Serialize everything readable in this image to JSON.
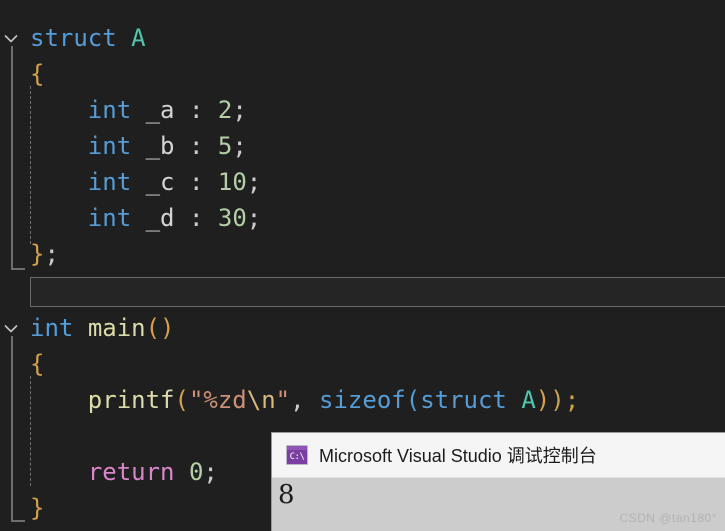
{
  "editor": {
    "background": "#1f1f1f",
    "font_size_px": 24,
    "folds": [
      {
        "name": "struct-fold",
        "icon": "chevron-down-icon"
      },
      {
        "name": "main-fold",
        "icon": "chevron-down-icon"
      }
    ],
    "lines": [
      {
        "id": "l1",
        "text": "struct A",
        "indent": 0
      },
      {
        "id": "l2",
        "text": "{",
        "indent": 0
      },
      {
        "id": "l3",
        "text": "    int _a : 2;",
        "indent": 1
      },
      {
        "id": "l4",
        "text": "    int _b : 5;",
        "indent": 1
      },
      {
        "id": "l5",
        "text": "    int _c : 10;",
        "indent": 1
      },
      {
        "id": "l6",
        "text": "    int _d : 30;",
        "indent": 1
      },
      {
        "id": "l7",
        "text": "};",
        "indent": 0
      },
      {
        "id": "l8",
        "text": "",
        "indent": 0
      },
      {
        "id": "l9",
        "text": "int main()",
        "indent": 0
      },
      {
        "id": "l10",
        "text": "{",
        "indent": 0
      },
      {
        "id": "l11",
        "text": "    printf(\"%zd\\n\", sizeof(struct A));",
        "indent": 1
      },
      {
        "id": "l12",
        "text": "",
        "indent": 1
      },
      {
        "id": "l13",
        "text": "    return 0;",
        "indent": 1
      },
      {
        "id": "l14",
        "text": "}",
        "indent": 0
      }
    ],
    "tokens": {
      "kw_struct": "struct",
      "type_a": "A",
      "brace_open": "{",
      "brace_close": "}",
      "semicolon": ";",
      "kw_int": "int",
      "field_a": "_a",
      "field_b": "_b",
      "field_c": "_c",
      "field_d": "_d",
      "colon": ":",
      "width_a": "2",
      "width_b": "5",
      "width_c": "10",
      "width_d": "30",
      "close_struct": "};",
      "fn_main": "main",
      "parens_empty": "()",
      "fn_printf": "printf",
      "paren_open": "(",
      "paren_close": ")",
      "str_quote": "\"",
      "str_fmt": "%zd",
      "str_escape": "\\n",
      "comma": ",",
      "kw_sizeof": "sizeof",
      "close_call": "));",
      "kw_return": "return",
      "num_zero": "0"
    },
    "colors": {
      "keyword": "#569cd6",
      "type": "#4ec9b0",
      "number": "#b5cea8",
      "string": "#ce9178",
      "escape": "#d7ba7d",
      "function": "#dcdcaa",
      "control": "#d886c8",
      "brace_gold": "#d4a24a",
      "brace_blue": "#569cd6",
      "plain": "#d4d4d4",
      "current_line_border": "#6b6b6b"
    }
  },
  "console": {
    "icon_name": "console-icon",
    "icon_text": "C:\\",
    "title": "Microsoft Visual Studio 调试控制台",
    "output": "8",
    "watermark": "CSDN @tan180°",
    "titlebar_color": "#f5f5f5",
    "body_color": "#cccccc"
  }
}
